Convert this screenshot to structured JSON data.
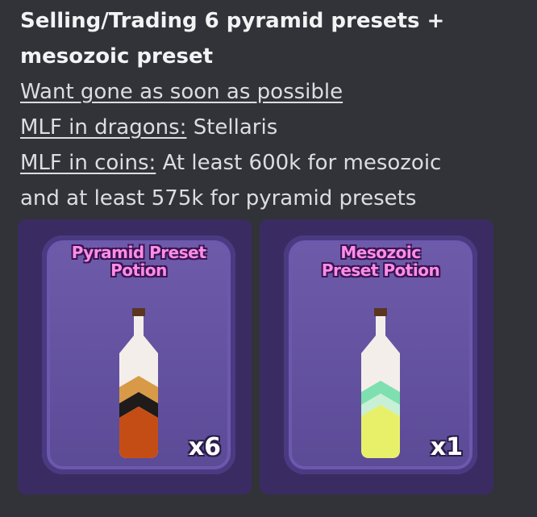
{
  "message": {
    "title_line1": "Selling/Trading 6 pyramid presets +",
    "title_line2": "mesozoic preset",
    "line1": "Want gone as soon as possible",
    "line2_label": "MLF in dragons:",
    "line2_value": " Stellaris",
    "line3_label": "MLF in coins:",
    "line3_value": " At least 600k for mesozoic",
    "line4": "and at least 575k for pyramid presets"
  },
  "items": [
    {
      "name_line1": "Pyramid Preset",
      "name_line2": "Potion",
      "quantity": "x6",
      "icon": "pyramid-preset-potion-bottle"
    },
    {
      "name_line1": "Mesozoic",
      "name_line2": "Preset Potion",
      "quantity": "x1",
      "icon": "mesozoic-preset-potion-bottle"
    }
  ],
  "colors": {
    "background": "#313338",
    "card": "#5b4a96",
    "card_title": "#ff8de8"
  }
}
